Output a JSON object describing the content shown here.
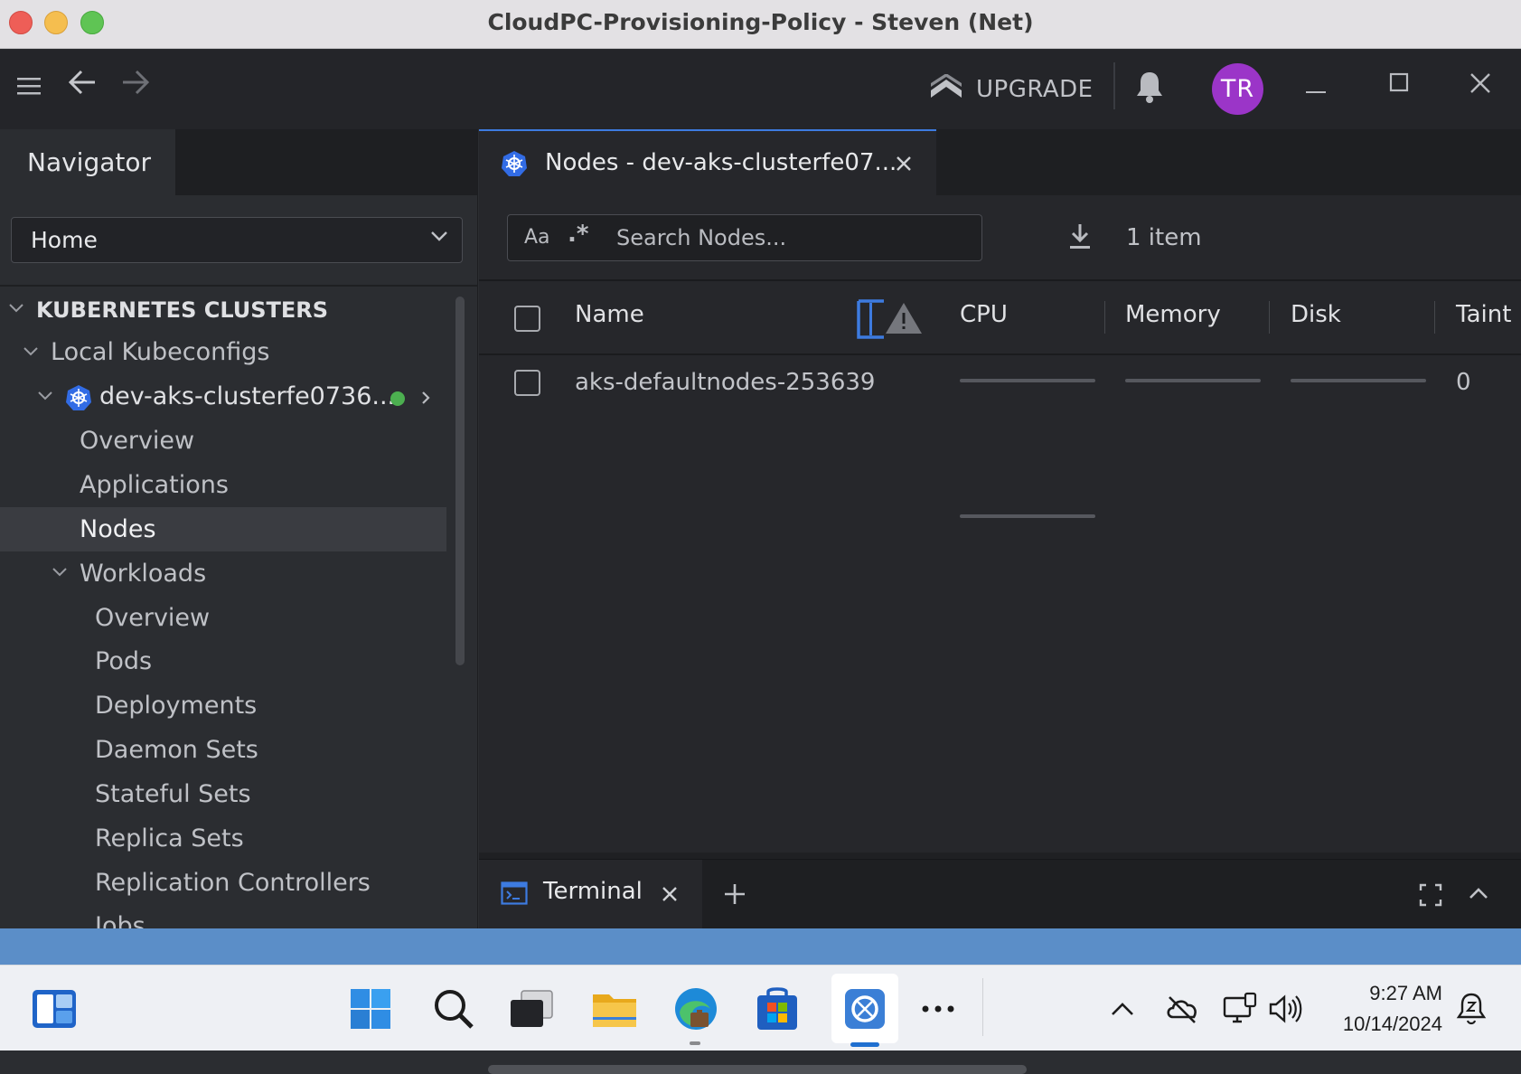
{
  "window": {
    "title": "CloudPC-Provisioning-Policy - Steven (Net)"
  },
  "topbar": {
    "upgrade_label": "UPGRADE",
    "avatar_initials": "TR"
  },
  "navigator": {
    "tab_label": "Navigator",
    "dropdown_value": "Home",
    "section_header": "KUBERNETES CLUSTERS",
    "group_label": "Local Kubeconfigs",
    "cluster_name": "dev-aks-clusterfe0736...",
    "cluster_status_color": "#4caf50",
    "items": {
      "overview": "Overview",
      "applications": "Applications",
      "nodes": "Nodes",
      "workloads": "Workloads"
    },
    "workloads_items": [
      "Overview",
      "Pods",
      "Deployments",
      "Daemon Sets",
      "Stateful Sets",
      "Replica Sets",
      "Replication Controllers",
      "Jobs"
    ]
  },
  "main": {
    "tab_label": "Nodes - dev-aks-clusterfe07...",
    "search_placeholder": "Search Nodes...",
    "search_case_label": "Aa",
    "search_regex_label": ".*",
    "item_count": "1 item",
    "columns": {
      "name": "Name",
      "cpu": "CPU",
      "memory": "Memory",
      "disk": "Disk",
      "taints": "Taint"
    },
    "rows": [
      {
        "name": "aks-defaultnodes-253639",
        "taints": "0"
      }
    ]
  },
  "dock": {
    "terminal_label": "Terminal"
  },
  "taskbar": {
    "time": "9:27 AM",
    "date": "10/14/2024"
  },
  "colors": {
    "accent": "#3d7be0",
    "avatar": "#9b35c8",
    "strip": "#5b8ec8"
  }
}
